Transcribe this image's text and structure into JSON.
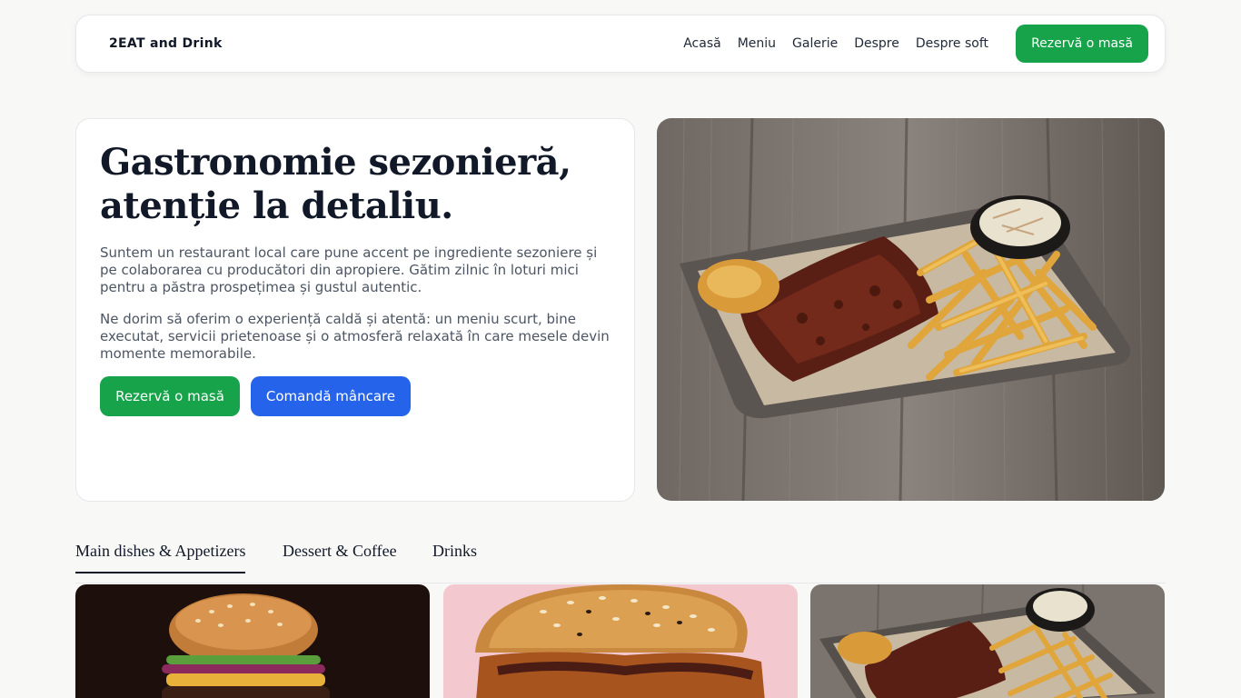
{
  "header": {
    "brand": "2EAT and Drink",
    "nav": [
      "Acasă",
      "Meniu",
      "Galerie",
      "Despre",
      "Despre soft"
    ],
    "cta": "Rezervă o masă"
  },
  "hero": {
    "title_line1": "Gastronomie sezonieră,",
    "title_line2": "atenție la detaliu.",
    "paragraph1": "Suntem un restaurant local care pune accent pe ingrediente sezoniere și pe colaborarea cu producători din apropiere. Gătim zilnic în loturi mici pentru a păstra prospețimea și gustul autentic.",
    "paragraph2": "Ne dorim să oferim o experiență caldă și atentă: un meniu scurt, bine executat, servicii prietenoase și o atmosferă relaxată în care mesele devin momente memorabile.",
    "btn_reserve": "Rezervă o masă",
    "btn_order": "Comandă mâncare"
  },
  "tabs": [
    "Main dishes & Appetizers",
    "Dessert & Coffee",
    "Drinks"
  ],
  "colors": {
    "green": "#16a34a",
    "blue": "#2563eb",
    "text": "#111827",
    "muted": "#4b5563"
  }
}
